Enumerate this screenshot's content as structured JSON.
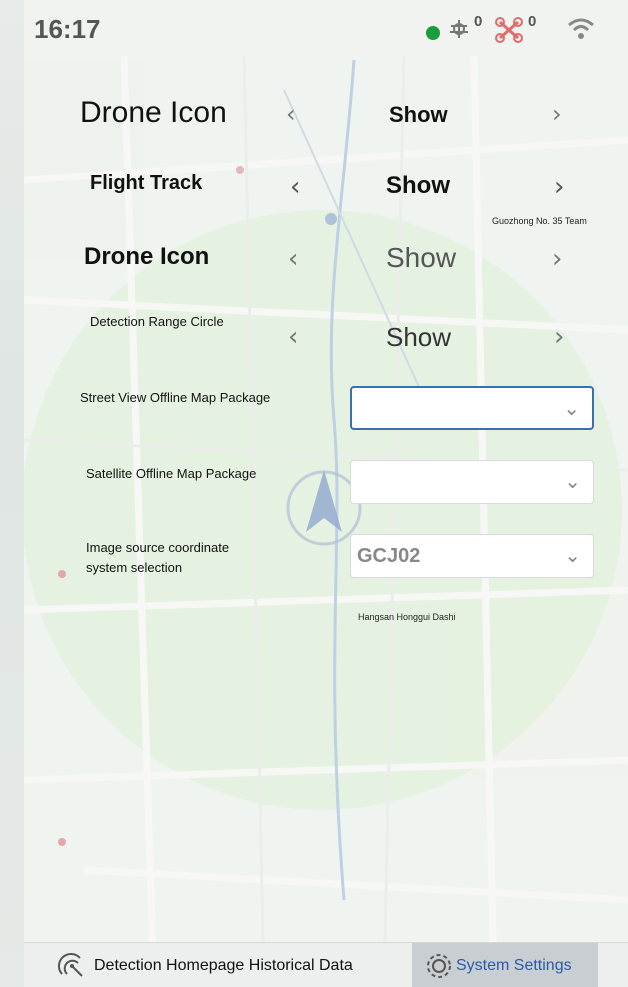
{
  "status_bar": {
    "time": "16:17",
    "status_dot_color": "#1b9e3a",
    "signal_count_1": "0",
    "signal_count_2": "0",
    "icons": [
      "connected-dot-icon",
      "antenna-icon",
      "drone-off-icon",
      "wifi-icon"
    ]
  },
  "settings": {
    "rows": [
      {
        "label": "Drone Icon",
        "value": "Show"
      },
      {
        "label": "Flight Track",
        "value": "Show"
      },
      {
        "label": "Drone Icon",
        "value": "Show"
      },
      {
        "label": "Detection Range Circle",
        "value": "Show"
      }
    ],
    "street_view_label": "Street View Offline Map Package",
    "street_view_value": "",
    "satellite_label": "Satellite Offline Map Package",
    "satellite_value": "",
    "coord_label_line1": "Image source coordinate",
    "coord_label_line2": "system selection",
    "coord_value": "GCJ02"
  },
  "map_labels": {
    "team": "Guozhong No. 35 Team",
    "building": "Hangsan Honggui Dashi"
  },
  "bottom_nav": {
    "home_label": "Detection Homepage Historical Data",
    "settings_label": "System Settings"
  }
}
